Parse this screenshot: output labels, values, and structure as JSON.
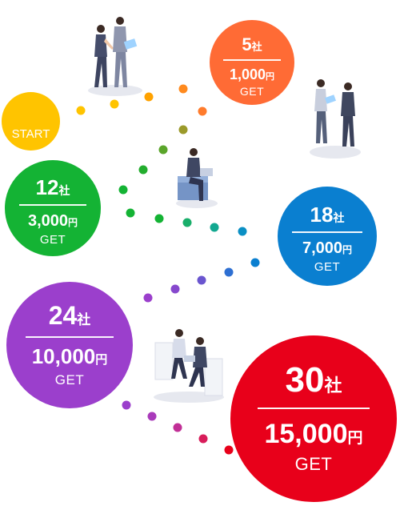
{
  "start": {
    "label": "START",
    "color": "#ffc400"
  },
  "milestones": [
    {
      "id": "m5",
      "count": "5",
      "count_unit": "社",
      "amount": "1,000",
      "amount_unit": "円",
      "get": "GET",
      "color": "#ff6b35"
    },
    {
      "id": "m12",
      "count": "12",
      "count_unit": "社",
      "amount": "3,000",
      "amount_unit": "円",
      "get": "GET",
      "color": "#14b334"
    },
    {
      "id": "m18",
      "count": "18",
      "count_unit": "社",
      "amount": "7,000",
      "amount_unit": "円",
      "get": "GET",
      "color": "#0a7fd0"
    },
    {
      "id": "m24",
      "count": "24",
      "count_unit": "社",
      "amount": "10,000",
      "amount_unit": "円",
      "get": "GET",
      "color": "#9b3fcc"
    },
    {
      "id": "m30",
      "count": "30",
      "count_unit": "社",
      "amount": "15,000",
      "amount_unit": "円",
      "get": "GET",
      "color": "#e8001a"
    }
  ],
  "illustrations": [
    "walking-business-people",
    "handshake-business-people",
    "person-laptop-sofa",
    "meeting-sofa-people"
  ]
}
